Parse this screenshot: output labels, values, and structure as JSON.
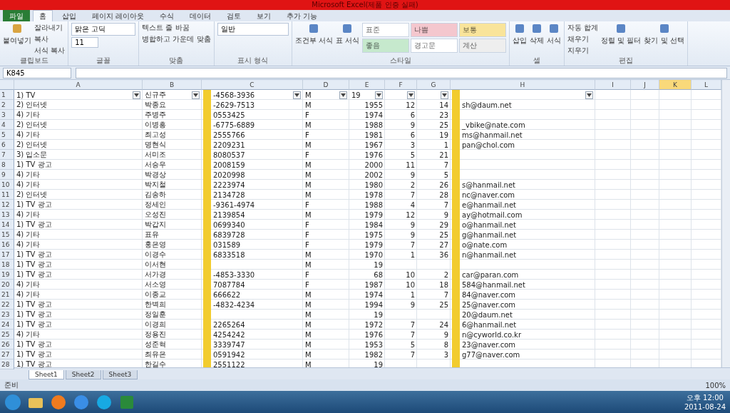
{
  "window": {
    "title": "Microsoft Excel(제품 인증 실패)"
  },
  "ribbon_tabs": [
    {
      "label": "파일",
      "selected": false,
      "kind": "file"
    },
    {
      "label": "홈",
      "selected": true,
      "kind": "tab"
    },
    {
      "label": "삽입",
      "selected": false,
      "kind": "tab"
    },
    {
      "label": "페이지 레이아웃",
      "selected": false,
      "kind": "tab"
    },
    {
      "label": "수식",
      "selected": false,
      "kind": "tab"
    },
    {
      "label": "데이터",
      "selected": false,
      "kind": "tab"
    },
    {
      "label": "검토",
      "selected": false,
      "kind": "tab"
    },
    {
      "label": "보기",
      "selected": false,
      "kind": "tab"
    },
    {
      "label": "추가 기능",
      "selected": false,
      "kind": "tab"
    }
  ],
  "ribbon_groups": [
    {
      "label": "클립보드",
      "big": "붙여넣기",
      "small": [
        "잘라내기",
        "복사",
        "서식 복사"
      ]
    },
    {
      "label": "글꼴",
      "font": "맑은 고딕",
      "size": "11"
    },
    {
      "label": "맞춤",
      "small": [
        "텍스트 줄 바꿈",
        "병합하고 가운데 맞춤"
      ]
    },
    {
      "label": "표시 형식",
      "format": "일반"
    },
    {
      "label": "스타일",
      "bigs": [
        "조건부 서식",
        "표 서식"
      ],
      "styles": [
        {
          "label": "표준",
          "color": "#ffffff"
        },
        {
          "label": "나쁨",
          "color": "#f4c7ce"
        },
        {
          "label": "보통",
          "color": "#f9e49a"
        },
        {
          "label": "좋음",
          "color": "#c6e9cd"
        },
        {
          "label": "경고문",
          "color": "#ffffff"
        },
        {
          "label": "계산",
          "color": "#eeeeee"
        }
      ]
    },
    {
      "label": "셀",
      "bigs": [
        "삽입",
        "삭제",
        "서식"
      ]
    },
    {
      "label": "편집",
      "small": [
        "자동 합계",
        "채우기",
        "지우기"
      ],
      "bigs": [
        "정렬 및 필터",
        "찾기 및 선택"
      ]
    }
  ],
  "name_box": "K845",
  "autofilter": true,
  "columns": [
    {
      "label": "A",
      "selected": false
    },
    {
      "label": "B",
      "selected": false
    },
    {
      "label": "C",
      "selected": false
    },
    {
      "label": "D",
      "selected": false
    },
    {
      "label": "E",
      "selected": false
    },
    {
      "label": "F",
      "selected": false
    },
    {
      "label": "G",
      "selected": false
    },
    {
      "label": "H",
      "selected": false
    },
    {
      "label": "I",
      "selected": false
    },
    {
      "label": "J",
      "selected": false
    },
    {
      "label": "K",
      "selected": true
    },
    {
      "label": "L",
      "selected": false
    }
  ],
  "rows": [
    {
      "n": "1",
      "cells": [
        "1) TV",
        "신규주",
        "-4568-3936",
        "M",
        "19",
        "",
        "",
        ""
      ]
    },
    {
      "n": "2",
      "cells": [
        "2) 인터넷",
        "박종요",
        "-2629-7513",
        "M",
        "1955",
        "12",
        "14",
        "sh@daum.net"
      ]
    },
    {
      "n": "3",
      "cells": [
        "4) 기타",
        "주병주",
        "0553425",
        "F",
        "1974",
        "6",
        "23",
        ""
      ]
    },
    {
      "n": "4",
      "cells": [
        "2) 인터넷",
        "이병흥",
        "-6775-6889",
        "M",
        "1988",
        "9",
        "25",
        "_vbike@nate.com"
      ]
    },
    {
      "n": "5",
      "cells": [
        "4) 기타",
        "최고성",
        "2555766",
        "F",
        "1981",
        "6",
        "19",
        "ms@hanmail.net"
      ]
    },
    {
      "n": "6",
      "cells": [
        "2) 인터넷",
        "명현식",
        "2209231",
        "M",
        "1967",
        "3",
        "1",
        "pan@chol.com"
      ]
    },
    {
      "n": "7",
      "cells": [
        "3) 입소문",
        "서미조",
        "8080537",
        "F",
        "1976",
        "5",
        "21",
        ""
      ]
    },
    {
      "n": "8",
      "cells": [
        "1) TV 광고",
        "서승우",
        "2008159",
        "M",
        "2000",
        "11",
        "7",
        ""
      ]
    },
    {
      "n": "9",
      "cells": [
        "4) 기타",
        "박경상",
        "2020998",
        "M",
        "2002",
        "9",
        "5",
        ""
      ]
    },
    {
      "n": "10",
      "cells": [
        "4) 기타",
        "박지철",
        "2223974",
        "M",
        "1980",
        "2",
        "26",
        "s@hanmail.net"
      ]
    },
    {
      "n": "11",
      "cells": [
        "2) 인터넷",
        "김송하",
        "2134728",
        "M",
        "1978",
        "7",
        "28",
        "nc@naver.com"
      ]
    },
    {
      "n": "12",
      "cells": [
        "1) TV 광고",
        "정세인",
        "-9361-4974",
        "F",
        "1988",
        "4",
        "7",
        "e@hanmail.net"
      ]
    },
    {
      "n": "13",
      "cells": [
        "4) 기타",
        "오성진",
        "2139854",
        "M",
        "1979",
        "12",
        "9",
        "ay@hotmail.com"
      ]
    },
    {
      "n": "14",
      "cells": [
        "1) TV 광고",
        "박갑지",
        "0699340",
        "F",
        "1984",
        "9",
        "29",
        "o@hanmail.net"
      ]
    },
    {
      "n": "15",
      "cells": [
        "4) 기타",
        "표유",
        "6839728",
        "F",
        "1975",
        "9",
        "25",
        "g@hanmail.net"
      ]
    },
    {
      "n": "16",
      "cells": [
        "4) 기타",
        "홍은영",
        "031589",
        "F",
        "1979",
        "7",
        "27",
        "o@nate.com"
      ]
    },
    {
      "n": "17",
      "cells": [
        "1) TV 광고",
        "이경수",
        "6833518",
        "M",
        "1970",
        "1",
        "36",
        "n@hanmail.net"
      ]
    },
    {
      "n": "18",
      "cells": [
        "1) TV 광고",
        "이서현",
        "",
        "M",
        "19",
        "",
        "",
        ""
      ]
    },
    {
      "n": "19",
      "cells": [
        "1) TV 광고",
        "서가경",
        "-4853-3330",
        "F",
        "68",
        "10",
        "2",
        "car@paran.com"
      ]
    },
    {
      "n": "20",
      "cells": [
        "4) 기타",
        "서소영",
        "7087784",
        "F",
        "1987",
        "10",
        "18",
        "584@hanmail.net"
      ]
    },
    {
      "n": "21",
      "cells": [
        "4) 기타",
        "이종교",
        "666622",
        "M",
        "1974",
        "1",
        "7",
        "84@naver.com"
      ]
    },
    {
      "n": "22",
      "cells": [
        "1) TV 광고",
        "한벽희",
        "-4832-4234",
        "M",
        "1994",
        "9",
        "25",
        "25@naver.com"
      ]
    },
    {
      "n": "23",
      "cells": [
        "1) TV 광고",
        "정일훈",
        "",
        "M",
        "19",
        "",
        "",
        "20@daum.net"
      ]
    },
    {
      "n": "24",
      "cells": [
        "1) TV 광고",
        "이경희",
        "2265264",
        "M",
        "1972",
        "7",
        "24",
        "6@hanmail.net"
      ]
    },
    {
      "n": "25",
      "cells": [
        "4) 기타",
        "정용진",
        "4254242",
        "M",
        "1976",
        "7",
        "9",
        "n@cyworld.co.kr"
      ]
    },
    {
      "n": "26",
      "cells": [
        "1) TV 광고",
        "성준혁",
        "3339747",
        "M",
        "1953",
        "5",
        "8",
        "23@naver.com"
      ]
    },
    {
      "n": "27",
      "cells": [
        "1) TV 광고",
        "최유은",
        "0591942",
        "M",
        "1982",
        "7",
        "3",
        "g77@naver.com"
      ]
    },
    {
      "n": "28",
      "cells": [
        "1) TV 광고",
        "한길수",
        "2551122",
        "M",
        "19",
        "",
        "",
        ""
      ]
    }
  ],
  "sheet_tabs": [
    {
      "label": "Sheet1",
      "selected": true
    },
    {
      "label": "Sheet2",
      "selected": false
    },
    {
      "label": "Sheet3",
      "selected": false
    }
  ],
  "status_bar": {
    "mode": "준비",
    "zoom": "100%"
  },
  "taskbar": {
    "time": "오후 12:00",
    "date": "2011-08-24"
  }
}
